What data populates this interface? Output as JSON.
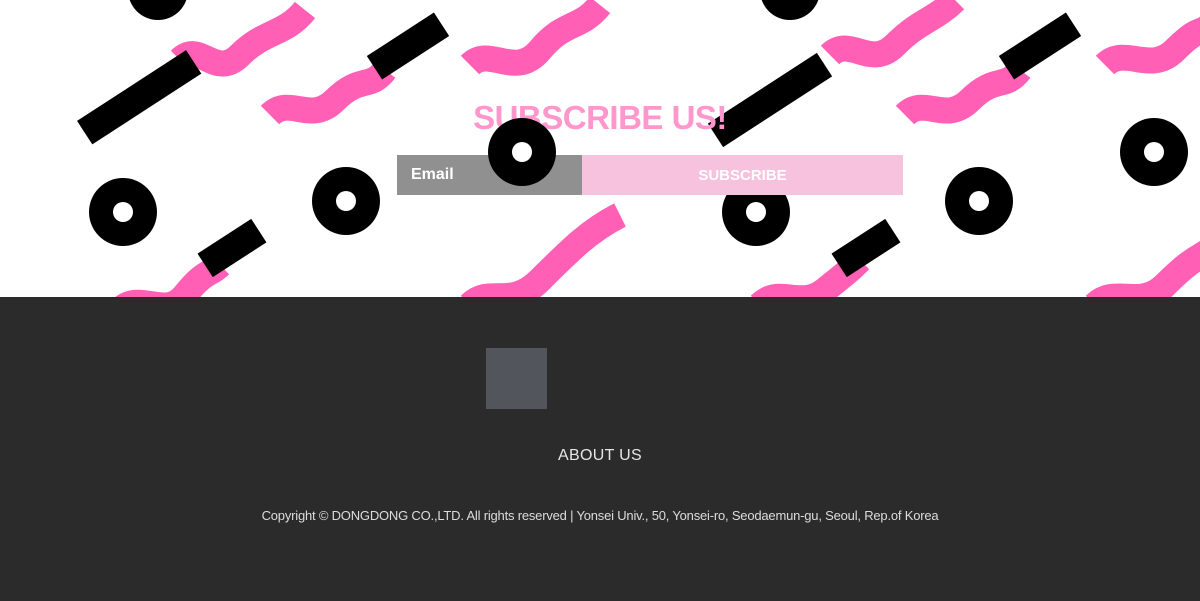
{
  "subscribe": {
    "title": "SUBSCRIBE US!",
    "email_placeholder": "Email",
    "button_label": "SUBSCRIBE"
  },
  "footer": {
    "about_label": "ABOUT US",
    "copyright": "Copyright © DONGDONG CO.,LTD. All rights reserved | Yonsei Univ., 50, Yonsei-ro, Seodaemun-gu, Seoul, Rep.of Korea"
  },
  "colors": {
    "pink": "#ff5fb4",
    "title_pink": "#ff96cc",
    "button_pink": "#f7c2de",
    "input_gray": "#909090",
    "footer_bg": "#2b2b2b",
    "logo_placeholder": "#52565c"
  },
  "icons": {
    "pattern": "memphis-shapes-pattern",
    "logo": "logo-placeholder"
  }
}
